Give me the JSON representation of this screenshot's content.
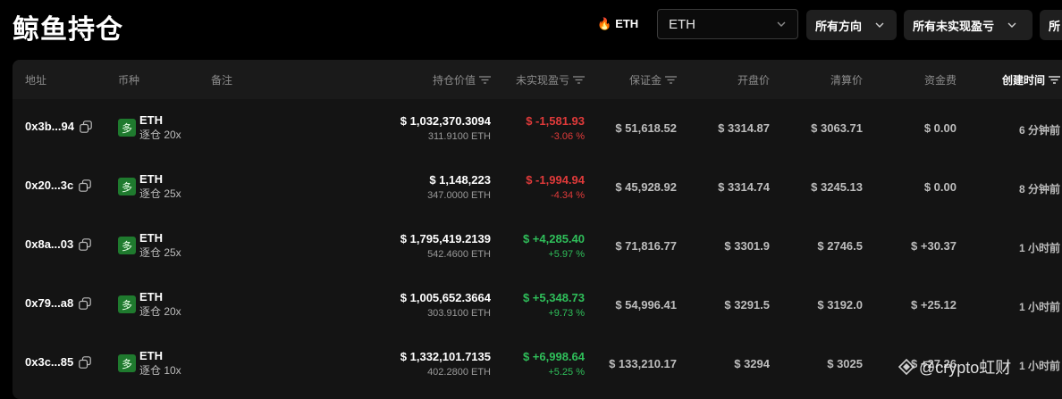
{
  "page": {
    "title": "鲸鱼持仓"
  },
  "toolbar": {
    "hot_label": "ETH",
    "coin_select_value": "ETH",
    "direction_filter": "所有方向",
    "pnl_filter": "所有未实现盈亏",
    "extra_filter": "所"
  },
  "table": {
    "headers": {
      "address": "地址",
      "coin": "币种",
      "note": "备注",
      "value": "持仓价值",
      "pnl": "未实现盈亏",
      "margin": "保证金",
      "entry": "开盘价",
      "liq": "清算价",
      "funding": "资金费",
      "created": "创建时间"
    },
    "rows": [
      {
        "address": "0x3b...94",
        "badge": "多",
        "coin": "ETH",
        "leverage": "逐仓 20x",
        "value": "$ 1,032,370.3094",
        "amount": "311.9100 ETH",
        "pnl": "$ -1,581.93",
        "pnl_pct": "-3.06 %",
        "pnl_sign": "neg",
        "margin": "$ 51,618.52",
        "entry": "$ 3314.87",
        "liq": "$ 3063.71",
        "funding": "$ 0.00",
        "funding_sign": "zero",
        "created": "6 分钟前"
      },
      {
        "address": "0x20...3c",
        "badge": "多",
        "coin": "ETH",
        "leverage": "逐仓 25x",
        "value": "$ 1,148,223",
        "amount": "347.0000 ETH",
        "pnl": "$ -1,994.94",
        "pnl_pct": "-4.34 %",
        "pnl_sign": "neg",
        "margin": "$ 45,928.92",
        "entry": "$ 3314.74",
        "liq": "$ 3245.13",
        "funding": "$ 0.00",
        "funding_sign": "zero",
        "created": "8 分钟前"
      },
      {
        "address": "0x8a...03",
        "badge": "多",
        "coin": "ETH",
        "leverage": "逐仓 25x",
        "value": "$ 1,795,419.2139",
        "amount": "542.4600 ETH",
        "pnl": "$ +4,285.40",
        "pnl_pct": "+5.97 %",
        "pnl_sign": "pos",
        "margin": "$ 71,816.77",
        "entry": "$ 3301.9",
        "liq": "$ 2746.5",
        "funding": "$ +30.37",
        "funding_sign": "pos",
        "created": "1 小时前"
      },
      {
        "address": "0x79...a8",
        "badge": "多",
        "coin": "ETH",
        "leverage": "逐仓 20x",
        "value": "$ 1,005,652.3664",
        "amount": "303.9100 ETH",
        "pnl": "$ +5,348.73",
        "pnl_pct": "+9.73 %",
        "pnl_sign": "pos",
        "margin": "$ 54,996.41",
        "entry": "$ 3291.5",
        "liq": "$ 3192.0",
        "funding": "$ +25.12",
        "funding_sign": "pos",
        "created": "1 小时前"
      },
      {
        "address": "0x3c...85",
        "badge": "多",
        "coin": "ETH",
        "leverage": "逐仓 10x",
        "value": "$ 1,332,101.7135",
        "amount": "402.2800 ETH",
        "pnl": "$ +6,998.64",
        "pnl_pct": "+5.25 %",
        "pnl_sign": "pos",
        "margin": "$ 133,210.17",
        "entry": "$ 3294",
        "liq": "$ 3025",
        "funding": "$ +27.26",
        "funding_sign": "pos",
        "created": "1 小时前"
      }
    ]
  },
  "watermark": {
    "text": "@crypto虹财",
    "icon": "diamond-logo-icon"
  },
  "colors": {
    "negative": "#e03a3a",
    "positive": "#2fbf5a",
    "badge": "#1f7a2e"
  }
}
